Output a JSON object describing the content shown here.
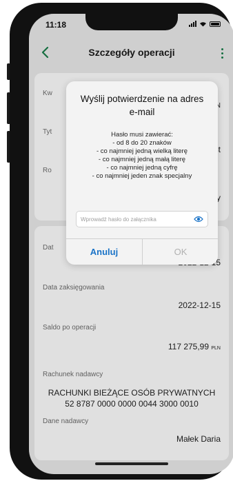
{
  "status_bar": {
    "time": "11:18"
  },
  "header": {
    "title": "Szczegóły operacji"
  },
  "card1": {
    "labels": [
      "Kw",
      "Tyt",
      "Ro"
    ],
    "values": [
      "PLN",
      "est",
      "ący"
    ]
  },
  "card2": {
    "date_label": "Dat",
    "date_value": "2022-12-15",
    "posting_label": "Data zaksięgowania",
    "posting_value": "2022-12-15",
    "balance_label": "Saldo po operacji",
    "balance_amount": "117 275,99",
    "balance_currency": "PLN",
    "sender_account_label": "Rachunek nadawcy",
    "sender_account_name": "RACHUNKI BIEŻĄCE OSÓB PRYWATNYCH",
    "sender_account_number": "52 8787 0000 0000 0044 3000 0010",
    "sender_data_label": "Dane nadawcy",
    "sender_name": "Małek Daria"
  },
  "dialog": {
    "title_line1": "Wyślij potwierdzenie na adres",
    "title_line2": "e-mail",
    "rules": [
      "Hasło musi zawierać:",
      "- od 8 do 20 znaków",
      "- co najmniej jedną wielką literę",
      "- co najmniej jedną małą literę",
      "- co najmniej jedną cyfrę",
      "- co najmniej jeden znak specjalny"
    ],
    "password_placeholder": "Wprowadź hasło do załącznika",
    "password_value": "",
    "cancel_label": "Anuluj",
    "ok_label": "OK"
  },
  "colors": {
    "accent_green": "#1a7f4b",
    "link_blue": "#1a73c7",
    "disabled_gray": "#b0b0b0"
  },
  "icons": {
    "back": "chevron-left-icon",
    "more": "more-vertical-icon",
    "eye": "eye-icon"
  }
}
